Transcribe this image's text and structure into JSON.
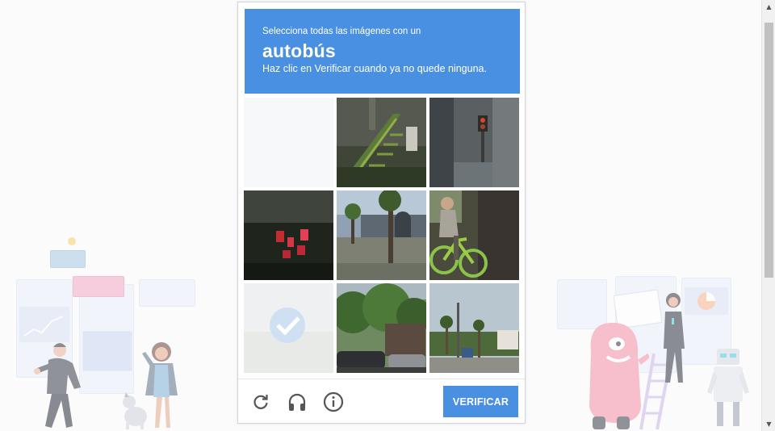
{
  "captcha": {
    "instruction_line1": "Selecciona todas las imágenes con un",
    "target_object": "autobús",
    "instruction_line3": "Haz clic en Verificar cuando ya no quede ninguna.",
    "verify_label": "VERIFICAR",
    "tiles": [
      {
        "index": 0,
        "state": "empty-fading"
      },
      {
        "index": 1,
        "state": "image",
        "content": "building with green stairs"
      },
      {
        "index": 2,
        "state": "image",
        "content": "traffic light on pole"
      },
      {
        "index": 3,
        "state": "image",
        "content": "dark red lights"
      },
      {
        "index": 4,
        "state": "image",
        "content": "palm trees and building"
      },
      {
        "index": 5,
        "state": "image",
        "content": "person on green bicycle"
      },
      {
        "index": 6,
        "state": "selected-fading"
      },
      {
        "index": 7,
        "state": "image",
        "content": "trees and parked cars"
      },
      {
        "index": 8,
        "state": "image",
        "content": "street with palm trees"
      }
    ],
    "footer_icons": [
      "reload-icon",
      "audio-headphones-icon",
      "info-icon"
    ],
    "colors": {
      "accent": "#4a90e2",
      "border": "#d4d4d4"
    }
  }
}
